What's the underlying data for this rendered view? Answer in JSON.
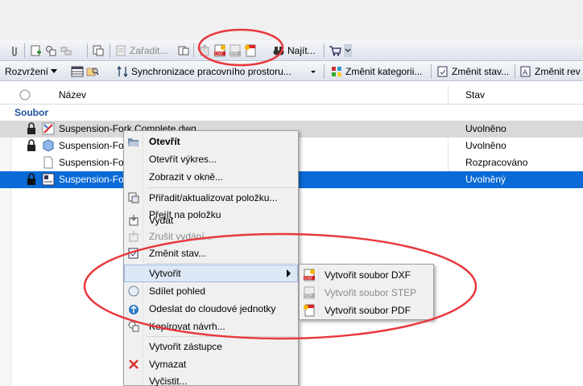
{
  "toolbar1": {
    "assign_label": "Zařadit...",
    "find_label": "Najít..."
  },
  "toolbar2": {
    "layout_label": "Rozvržení",
    "sync_label": "Synchronizace pracovního prostoru...",
    "change_category_label": "Změnit kategorii...",
    "change_state_label": "Změnit stav...",
    "change_revision_label": "Změnit rev"
  },
  "table": {
    "header_name": "Název",
    "header_state": "Stav",
    "group_label": "Soubor",
    "rows": [
      {
        "name": "Suspension-Fork Complete.dwg",
        "state": "Uvolněno"
      },
      {
        "name": "Suspension-Fo",
        "state": "Uvolněno"
      },
      {
        "name": "Suspension-Fo",
        "state": "Rozpracováno"
      },
      {
        "name": "Suspension-Fo",
        "state": "Uvolněný"
      }
    ]
  },
  "context_menu": {
    "items": [
      {
        "label": "Otevřít"
      },
      {
        "label": "Otevřít výkres..."
      },
      {
        "label": "Zobrazit v okně..."
      },
      {
        "label": "Přiřadit/aktualizovat položku..."
      },
      {
        "label": "Přejít na položku"
      },
      {
        "label": "Vydat"
      },
      {
        "label": "Zrušit vydání..."
      },
      {
        "label": "Změnit stav..."
      },
      {
        "label": "Vytvořit"
      },
      {
        "label": "Sdílet pohled"
      },
      {
        "label": "Odeslat do cloudové jednotky"
      },
      {
        "label": "Kopírovat návrh..."
      },
      {
        "label": "Vytvořit zástupce"
      },
      {
        "label": "Vymazat"
      },
      {
        "label": "Vyčistit..."
      }
    ]
  },
  "submenu": {
    "items": [
      {
        "label": "Vytvořit soubor DXF"
      },
      {
        "label": "Vytvořit soubor STEP"
      },
      {
        "label": "Vytvořit soubor PDF"
      }
    ]
  },
  "colors": {
    "selection": "#0a6ad6",
    "annotation": "#e8383d",
    "menu_highlight": "#dde8f6"
  }
}
